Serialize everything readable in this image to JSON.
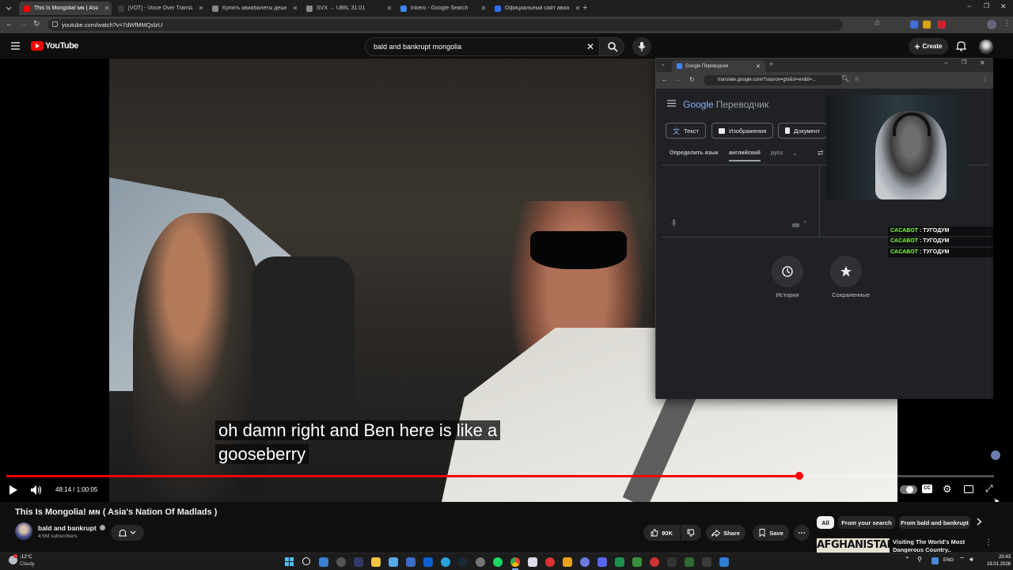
{
  "browser": {
    "tabs": [
      {
        "title": "This Is Mongolia! ᴍɴ ( Asia's N",
        "color": "#ff0000",
        "active": true
      },
      {
        "title": "[VOT] - Voice Over Translation",
        "color": "#3a3a3a",
        "active": false
      },
      {
        "title": "Купить авиабилеты дешево о",
        "color": "#888888",
        "active": false
      },
      {
        "title": "SVX → UBN, 31.01",
        "color": "#888888",
        "active": false
      },
      {
        "title": "Inkero - Google Search",
        "color": "#4285f4",
        "active": false
      },
      {
        "title": "Официальный сайт авиаком",
        "color": "#2f6ff3",
        "active": false
      }
    ],
    "url": "youtube.com/watch?v=7dWfMMQslzU"
  },
  "youtube": {
    "logo": "YouTube",
    "search_query": "bald and bankrupt mongolia",
    "create_label": "Create",
    "create_plus": "+"
  },
  "player": {
    "subtitle_line1": "oh damn right and Ben here is like a",
    "subtitle_line2": "gooseberry",
    "time": "48:14 / 1:00:05",
    "progress": 0.803
  },
  "translate_window": {
    "tab_title": "Google Переводчик",
    "url": "translate.google.com/?source=gtx&sl=en&tl=...",
    "logo_google": "Google",
    "logo_product": "Переводчик",
    "modes": [
      "Текст",
      "Изображения",
      "Документ"
    ],
    "lang_detect": "Определить язык",
    "lang_source": "английский",
    "lang_target": "русс",
    "history_label": "История",
    "saved_label": "Сохраненные"
  },
  "chat": [
    {
      "user": "CACABOT",
      "sep": " : ",
      "msg": "ТУГОДУМ"
    },
    {
      "user": "CACABOT",
      "sep": " : ",
      "msg": "ТУГОДУМ"
    },
    {
      "user": "CACABOT",
      "sep": " : ",
      "msg": "ТУГОДУМ"
    }
  ],
  "video_info": {
    "title": "This Is Mongolia! ᴍɴ ( Asia's Nation Of Madlads )",
    "channel": "bald and bankrupt",
    "subscribers": "4.5M subscribers",
    "likes": "90K",
    "share": "Share",
    "save": "Save"
  },
  "recommendations": {
    "chips": [
      "All",
      "From your search",
      "From bald and bankrupt"
    ],
    "first_video_title": "Visiting The World's Most",
    "first_video_title2": "Dangerous Country..",
    "thumb_text": "AFGHANISTAN"
  },
  "taskbar": {
    "weather_temp": "-12°C",
    "weather_desc": "Cloudy",
    "lang": "ENG",
    "time": "20:43",
    "date": "19.01.2026"
  }
}
